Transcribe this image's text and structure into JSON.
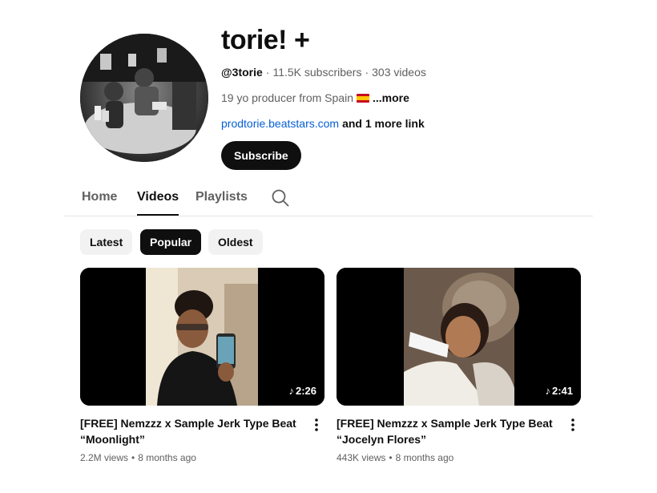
{
  "channel": {
    "name": "torie! +",
    "handle": "@3torie",
    "subscribers": "11.5K subscribers",
    "videos_count": "303 videos",
    "description": "19 yo producer from Spain",
    "description_more": "...more",
    "link": "prodtorie.beatstars.com",
    "more_links": "and 1 more link",
    "subscribe_label": "Subscribe",
    "separator": "·"
  },
  "tabs": [
    {
      "label": "Home",
      "active": false
    },
    {
      "label": "Videos",
      "active": true
    },
    {
      "label": "Playlists",
      "active": false
    }
  ],
  "chips": [
    {
      "label": "Latest",
      "selected": false
    },
    {
      "label": "Popular",
      "selected": true
    },
    {
      "label": "Oldest",
      "selected": false
    }
  ],
  "videos": [
    {
      "title": "[FREE] Nemzzz x Sample Jerk Type Beat\n“Moonlight”",
      "views": "2.2M views",
      "age": "8 months ago",
      "duration": "2:26"
    },
    {
      "title": "[FREE] Nemzzz x Sample Jerk Type Beat\n“Jocelyn Flores”",
      "views": "443K views",
      "age": "8 months ago",
      "duration": "2:41"
    }
  ],
  "icons": {
    "search": "search-icon",
    "music_note": "♪",
    "more": "more-vert-icon",
    "flag": "spain-flag-icon"
  },
  "colors": {
    "text": "#0f0f0f",
    "secondary": "#606060",
    "link": "#065fd4",
    "chip_bg": "#f2f2f2",
    "divider": "#e5e5e5"
  }
}
